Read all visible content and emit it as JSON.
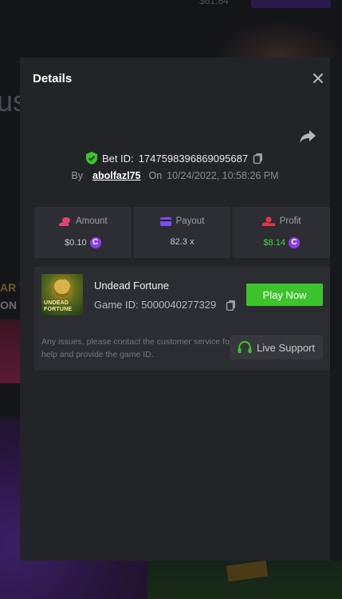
{
  "background": {
    "top_amount": "$61.84",
    "text_fragment": "us",
    "promo_fragment_1": "AR V",
    "promo_fragment_2": "ON"
  },
  "modal": {
    "title": "Details",
    "bet": {
      "id_label": "Bet ID:",
      "id_value": "1747598396869095687",
      "by_label": "By",
      "username": "abolfazl75",
      "on_label": "On",
      "datetime": "10/24/2022, 10:58:26 PM"
    },
    "stats": [
      {
        "label": "Amount",
        "value": "$0.10",
        "icon": "coins-icon",
        "coin_symbol": "C"
      },
      {
        "label": "Payout",
        "value": "82.3 x",
        "icon": "card-icon"
      },
      {
        "label": "Profit",
        "value": "$8.14",
        "icon": "profit-hand-icon",
        "coin_symbol": "C"
      }
    ],
    "game": {
      "thumb_line1": "UNDEAD",
      "thumb_line2": "FORTUNE",
      "name": "Undead Fortune",
      "id_label": "Game ID:",
      "id_value": "5000040277329",
      "play_label": "Play Now"
    },
    "support": {
      "notice": "Any issues, please contact the customer service for help and provide the game ID.",
      "button_label": "Live Support"
    }
  },
  "colors": {
    "accent_green": "#3dc42d",
    "profit_green": "#43d63a",
    "coin_purple": "#8b3cf0",
    "amount_pink": "#e8436c",
    "payout_purple": "#7b4cf2",
    "profit_red": "#e3364a"
  }
}
